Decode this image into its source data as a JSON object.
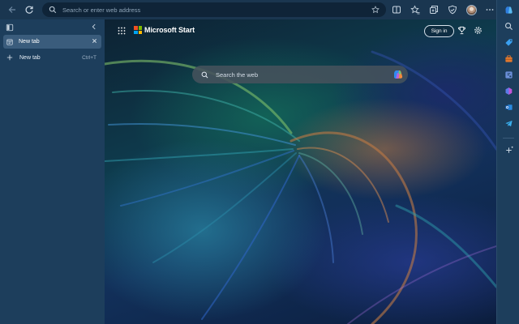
{
  "toolbar": {
    "address_placeholder": "Search or enter web address",
    "icons": [
      "back-icon",
      "refresh-icon",
      "search-icon",
      "favorite-star-icon",
      "split-screen-icon",
      "favorites-icon",
      "collections-icon",
      "browser-essentials-icon",
      "profile-avatar",
      "more-icon"
    ]
  },
  "tabs_pane": {
    "tabs": [
      {
        "label": "New tab",
        "active": true
      }
    ],
    "new_tab_label": "New tab",
    "new_tab_shortcut": "Ctrl+T"
  },
  "content": {
    "brand": "Microsoft Start",
    "sign_in_label": "Sign in",
    "search_placeholder": "Search the web",
    "logo_colors": [
      "#f25022",
      "#7fba00",
      "#00a4ef",
      "#ffb900"
    ]
  },
  "sidebar": {
    "icons": [
      "copilot-icon",
      "search-icon",
      "shopping-tag-icon",
      "tools-icon",
      "games-icon",
      "microsoft-365-icon",
      "outlook-icon",
      "telegram-icon",
      "add-icon"
    ]
  },
  "colors": {
    "chrome": "#1a3650",
    "pane": "#1d3e5c",
    "active_tab": "#3a5c7c"
  }
}
